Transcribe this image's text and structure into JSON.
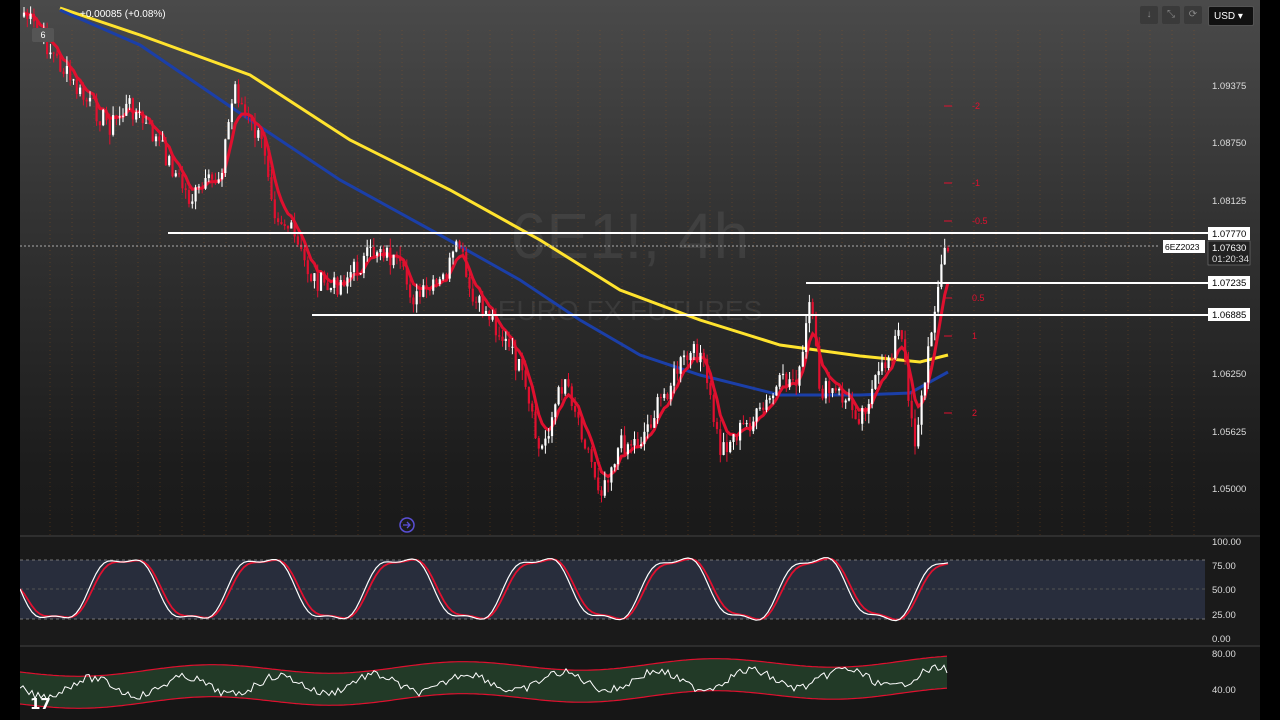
{
  "header": {
    "change": "+0.00085 (+0.08%)",
    "badge": "6",
    "currency": "USD"
  },
  "toolbar": [
    "↓",
    "⤡",
    "⟳"
  ],
  "watermark": {
    "line1": "6E1!, 4h",
    "line2": "EURO FX FUTURES"
  },
  "price_axis": {
    "labels": [
      "1.09375",
      "1.08750",
      "1.08125",
      "1.06250",
      "1.05625",
      "1.05000"
    ]
  },
  "levels": [
    {
      "price": "1.07770"
    },
    {
      "price": "1.07235"
    },
    {
      "price": "1.06885"
    }
  ],
  "current": {
    "symbol": "6EZ2023",
    "price": "1.07630",
    "countdown": "01:20:34"
  },
  "fib_labels": [
    "-2",
    "-1",
    "-0.5",
    "0.5",
    "1",
    "2"
  ],
  "stoch": {
    "labels": [
      "100.00",
      "75.00",
      "50.00",
      "25.00",
      "0.00"
    ]
  },
  "rsi": {
    "labels": [
      "80.00",
      "40.00"
    ]
  },
  "logo": "17",
  "colors": {
    "bull": "#ffffff",
    "bear": "#e0102f",
    "ema_fast": "#e0102f",
    "ema_mid": "#1b3fa8",
    "ema_slow": "#ffe32e"
  }
}
